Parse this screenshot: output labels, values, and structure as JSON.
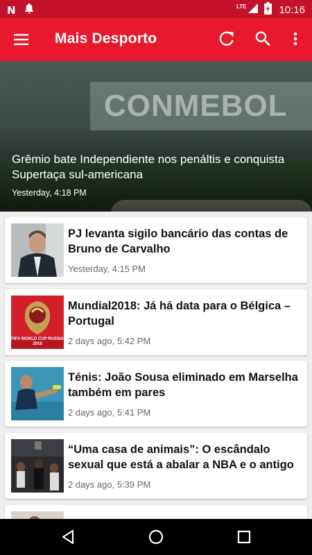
{
  "status_bar": {
    "notification_icons": [
      "n-app-icon",
      "bell-icon"
    ],
    "network": "LTE",
    "time": "10:16"
  },
  "app_bar": {
    "title": "Mais Desporto",
    "actions": [
      "menu-icon",
      "refresh-icon",
      "search-icon",
      "more-vert-icon"
    ]
  },
  "hero": {
    "title": "Grêmio bate Independiente nos penáltis e conquista Supertaça sul-americana",
    "time": "Yesterday, 4:18 PM",
    "background_text": "CONMEBOL"
  },
  "articles": [
    {
      "title": "PJ levanta sigilo bancário das contas de Bruno de Carvalho",
      "time": "Yesterday, 4:15 PM"
    },
    {
      "title": "Mundial2018: Já há data para o Bélgica – Portugal",
      "time": "2 days ago, 5:42 PM",
      "thumb_text": "FIFA WORLD CUP RUSSIA 2018"
    },
    {
      "title": "Ténis: João Sousa eliminado em Marselha também em pares",
      "time": "2 days ago, 5:41 PM"
    },
    {
      "title": "“Uma casa de animais”: O escândalo sexual que está a abalar a NBA e o antigo",
      "time": "2 days ago, 5:39 PM"
    },
    {
      "title": "",
      "time": ""
    }
  ],
  "nav": [
    "back-icon",
    "home-icon",
    "recents-icon"
  ],
  "colors": {
    "status_bar": "#c4122a",
    "app_bar": "#e8192f",
    "background": "#efefef"
  }
}
